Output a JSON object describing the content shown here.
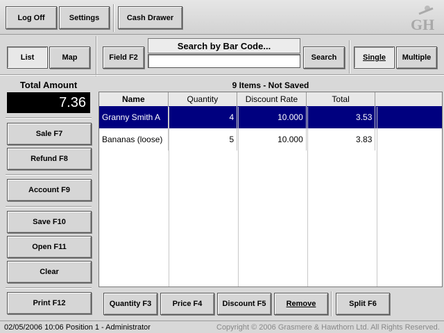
{
  "toolbar": {
    "log_off": "Log Off",
    "settings": "Settings",
    "cash_drawer": "Cash Drawer",
    "logo_text": "GH"
  },
  "view": {
    "list": "List",
    "map": "Map"
  },
  "search": {
    "field_button": "Field F2",
    "label": "Search by Bar Code...",
    "value": "",
    "button": "Search",
    "single": "Single",
    "multiple": "Multiple"
  },
  "totals": {
    "label": "Total Amount",
    "value": "7.36"
  },
  "side_buttons": {
    "sale": "Sale F7",
    "refund": "Refund F8",
    "account": "Account F9",
    "save": "Save F10",
    "open": "Open F11",
    "clear": "Clear",
    "print": "Print F12"
  },
  "grid": {
    "title": "9 Items - Not Saved",
    "columns": [
      "Name",
      "Quantity",
      "Discount Rate",
      "Total",
      ""
    ],
    "rows": [
      {
        "name": "Granny Smith A",
        "quantity": "4",
        "discount": "10.000",
        "total": "3.53",
        "selected": true
      },
      {
        "name": "Bananas (loose)",
        "quantity": "5",
        "discount": "10.000",
        "total": "3.83",
        "selected": false
      }
    ]
  },
  "bottom_buttons": {
    "quantity": "Quantity F3",
    "price": "Price F4",
    "discount": "Discount F5",
    "remove": "Remove",
    "split": "Split F6"
  },
  "status": {
    "left": "02/05/2006 10:06  Position 1 - Administrator",
    "right": "Copyright © 2006 Grasmere & Hawthorn Ltd. All Rights Reserved."
  }
}
